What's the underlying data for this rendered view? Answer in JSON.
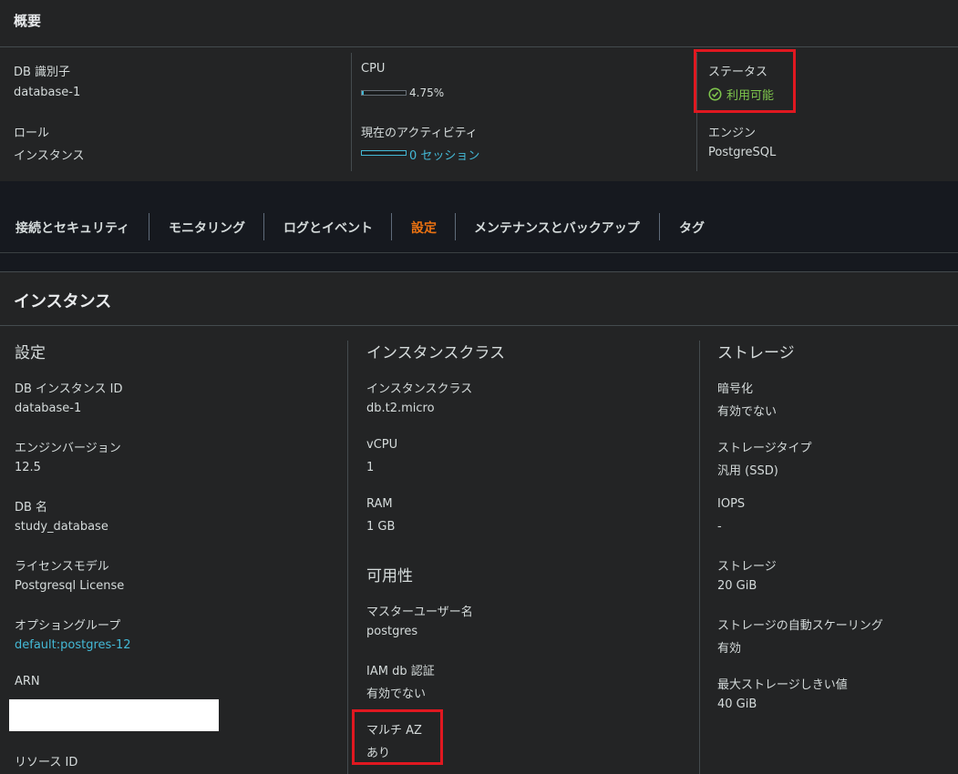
{
  "summary": {
    "title": "概要",
    "db_identifier": {
      "label": "DB 識別子",
      "value": "database-1"
    },
    "role": {
      "label": "ロール",
      "value": "インスタンス"
    },
    "cpu": {
      "label": "CPU",
      "value": "4.75%",
      "fraction": 0.0475
    },
    "activity": {
      "label": "現在のアクティビティ",
      "value": "0 セッション",
      "fraction": 0
    },
    "status": {
      "label": "ステータス",
      "value": "利用可能",
      "color": "#7ec54c",
      "icon": "check-circle-icon"
    },
    "engine": {
      "label": "エンジン",
      "value": "PostgreSQL"
    }
  },
  "tabs": [
    {
      "label": "接続とセキュリティ",
      "active": false
    },
    {
      "label": "モニタリング",
      "active": false
    },
    {
      "label": "ログとイベント",
      "active": false
    },
    {
      "label": "設定",
      "active": true
    },
    {
      "label": "メンテナンスとバックアップ",
      "active": false
    },
    {
      "label": "タグ",
      "active": false
    }
  ],
  "instance": {
    "title": "インスタンス",
    "config": {
      "heading": "設定",
      "instance_id": {
        "label": "DB インスタンス ID",
        "value": "database-1"
      },
      "engine_version": {
        "label": "エンジンバージョン",
        "value": "12.5"
      },
      "db_name": {
        "label": "DB 名",
        "value": "study_database"
      },
      "license_model": {
        "label": "ライセンスモデル",
        "value": "Postgresql License"
      },
      "option_group": {
        "label": "オプショングループ",
        "value": "default:postgres-12"
      },
      "arn": {
        "label": "ARN",
        "value": ""
      },
      "resource_id": {
        "label": "リソース ID"
      }
    },
    "instance_class": {
      "heading": "インスタンスクラス",
      "class": {
        "label": "インスタンスクラス",
        "value": "db.t2.micro"
      },
      "vcpu": {
        "label": "vCPU",
        "value": "1"
      },
      "ram": {
        "label": "RAM",
        "value": "1 GB"
      }
    },
    "availability": {
      "heading": "可用性",
      "master_user": {
        "label": "マスターユーザー名",
        "value": "postgres"
      },
      "iam_auth": {
        "label": "IAM db 認証",
        "value": "有効でない"
      },
      "multi_az": {
        "label": "マルチ AZ",
        "value": "あり"
      }
    },
    "storage": {
      "heading": "ストレージ",
      "encryption": {
        "label": "暗号化",
        "value": "有効でない"
      },
      "storage_type": {
        "label": "ストレージタイプ",
        "value": "汎用 (SSD)"
      },
      "iops": {
        "label": "IOPS",
        "value": "-"
      },
      "storage": {
        "label": "ストレージ",
        "value": "20 GiB"
      },
      "autoscaling": {
        "label": "ストレージの自動スケーリング",
        "value": "有効"
      },
      "max_threshold": {
        "label": "最大ストレージしきい値",
        "value": "40 GiB"
      }
    }
  }
}
